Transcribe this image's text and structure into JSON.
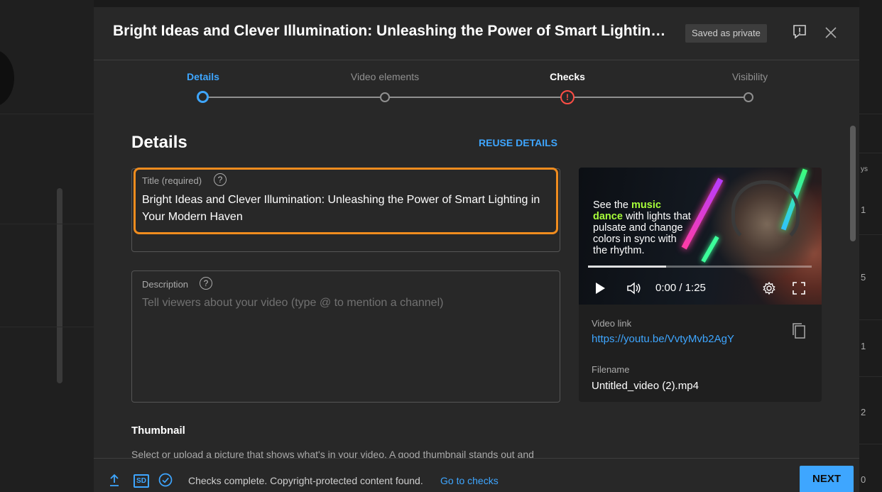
{
  "dialog": {
    "title": "Bright Ideas and Clever Illumination: Unleashing the Power of Smart Lighting in Your Modern Haven",
    "saved_badge": "Saved as private"
  },
  "stepper": {
    "steps": [
      {
        "label": "Details",
        "state": "current"
      },
      {
        "label": "Video elements",
        "state": "pending"
      },
      {
        "label": "Checks",
        "state": "warning"
      },
      {
        "label": "Visibility",
        "state": "pending"
      }
    ]
  },
  "details": {
    "heading": "Details",
    "reuse_label": "REUSE DETAILS",
    "title_field": {
      "label": "Title (required)",
      "value": "Bright Ideas and Clever Illumination: Unleashing the Power of Smart Lighting in Your Modern Haven"
    },
    "description_field": {
      "label": "Description",
      "placeholder": "Tell viewers about your video (type @ to mention a channel)"
    },
    "thumbnail": {
      "heading": "Thumbnail",
      "text": "Select or upload a picture that shows what's in your video. A good thumbnail stands out and"
    }
  },
  "preview": {
    "caption_prefix": "See the ",
    "caption_highlight": "music dance",
    "caption_rest": " with lights that pulsate and change colors in sync with the rhythm.",
    "time": "0:00 / 1:25",
    "progress_buffered": 0.35,
    "video_link_label": "Video link",
    "video_link": "https://youtu.be/VvtyMvb2AgY",
    "filename_label": "Filename",
    "filename": "Untitled_video (2).mp4"
  },
  "footer": {
    "status": "Checks complete. Copyright-protected content found.",
    "link": "Go to checks",
    "sd_badge": "SD",
    "next_label": "NEXT"
  },
  "background": {
    "right_numbers": [
      "1",
      "5",
      "1",
      "2",
      "0"
    ],
    "right_header": "ys"
  },
  "colors": {
    "accent": "#3ea6ff",
    "warning": "#ff4e45",
    "highlight": "#f08c1e",
    "music_highlight": "#a8ff3a"
  }
}
